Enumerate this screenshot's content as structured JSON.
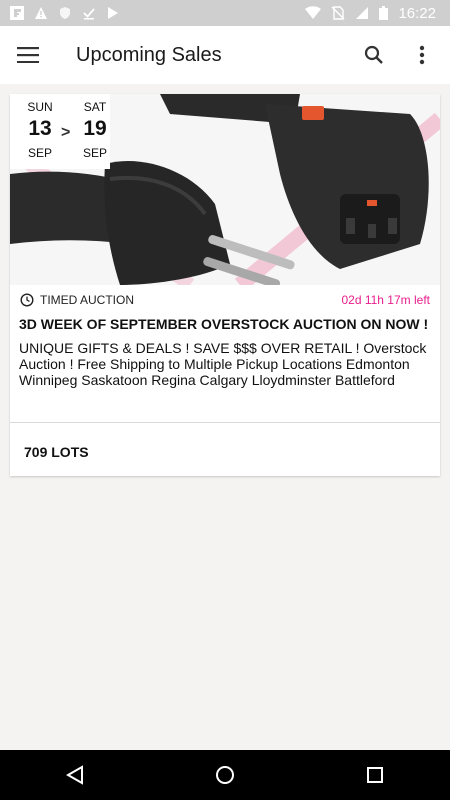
{
  "status_bar": {
    "time": "16:22",
    "left_icons": [
      "flipboard-icon",
      "warning-icon",
      "shield-icon",
      "download-done-icon",
      "play-store-icon"
    ],
    "right_icons": [
      "wifi-icon",
      "no-sim-icon",
      "signal-icon",
      "battery-icon"
    ]
  },
  "app_bar": {
    "title": "Upcoming Sales"
  },
  "sale": {
    "start": {
      "dow": "SUN",
      "day": "13",
      "month": "SEP"
    },
    "arrow": ">",
    "end": {
      "dow": "SAT",
      "day": "19",
      "month": "SEP"
    },
    "type": "TIMED AUCTION",
    "time_left": "02d 11h 17m left",
    "title": "3D WEEK OF SEPTEMBER OVERSTOCK AUCTION ON NOW !",
    "description": "UNIQUE GIFTS & DEALS ! SAVE $$$ OVER RETAIL ! Overstock Auction ! Free Shipping to Multiple Pickup Locations Edmonton Winnipeg Saskatoon Regina Calgary Lloydminster Battleford",
    "lots": "709 LOTS"
  },
  "colors": {
    "accent_time": "#e91e8c",
    "status_bar": "#cfcfcf",
    "background": "#f4f3f1"
  }
}
